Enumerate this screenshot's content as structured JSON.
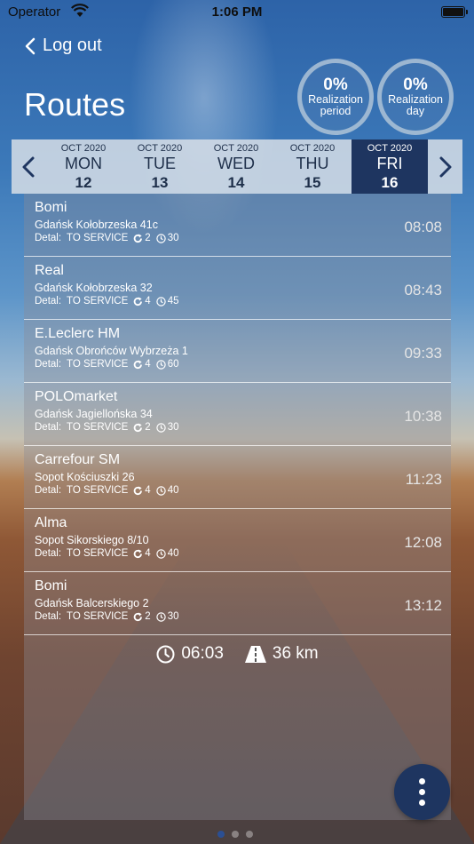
{
  "status_bar": {
    "carrier": "Operator",
    "time": "1:06 PM"
  },
  "header": {
    "logout_label": "Log out",
    "title": "Routes"
  },
  "gauges": [
    {
      "value": "0%",
      "label_line1": "Realization",
      "label_line2": "period"
    },
    {
      "value": "0%",
      "label_line1": "Realization",
      "label_line2": "day"
    }
  ],
  "days": [
    {
      "month": "OCT 2020",
      "dow": "MON",
      "num": "12"
    },
    {
      "month": "OCT 2020",
      "dow": "TUE",
      "num": "13"
    },
    {
      "month": "OCT 2020",
      "dow": "WED",
      "num": "14"
    },
    {
      "month": "OCT 2020",
      "dow": "THU",
      "num": "15"
    },
    {
      "month": "OCT 2020",
      "dow": "FRI",
      "num": "16"
    }
  ],
  "selected_day": "FRI",
  "routes": [
    {
      "name": "Bomi",
      "address": "Gdańsk Kołobrzeska 41c",
      "detail_label": "Detal:",
      "service": "TO SERVICE",
      "repeat": "2",
      "minutes": "30",
      "time": "08:08"
    },
    {
      "name": "Real",
      "address": "Gdańsk Kołobrzeska 32",
      "detail_label": "Detal:",
      "service": "TO SERVICE",
      "repeat": "4",
      "minutes": "45",
      "time": "08:43"
    },
    {
      "name": "E.Leclerc HM",
      "address": "Gdańsk Obrońców Wybrzeża 1",
      "detail_label": "Detal:",
      "service": "TO SERVICE",
      "repeat": "4",
      "minutes": "60",
      "time": "09:33"
    },
    {
      "name": "POLOmarket",
      "address": "Gdańsk Jagiellońska 34",
      "detail_label": "Detal:",
      "service": "TO SERVICE",
      "repeat": "2",
      "minutes": "30",
      "time": "10:38"
    },
    {
      "name": "Carrefour SM",
      "address": "Sopot Kościuszki 26",
      "detail_label": "Detal:",
      "service": "TO SERVICE",
      "repeat": "4",
      "minutes": "40",
      "time": "11:23"
    },
    {
      "name": "Alma",
      "address": "Sopot Sikorskiego 8/10",
      "detail_label": "Detal:",
      "service": "TO SERVICE",
      "repeat": "4",
      "minutes": "40",
      "time": "12:08"
    },
    {
      "name": "Bomi",
      "address": "Gdańsk Balcerskiego 2",
      "detail_label": "Detal:",
      "service": "TO SERVICE",
      "repeat": "2",
      "minutes": "30",
      "time": "13:12"
    }
  ],
  "summary": {
    "duration": "06:03",
    "distance": "36 km"
  },
  "colors": {
    "accent_navy": "#1e3560",
    "day_bar": "#d7dee6"
  },
  "pager": {
    "count": 3,
    "active_index": 0
  }
}
